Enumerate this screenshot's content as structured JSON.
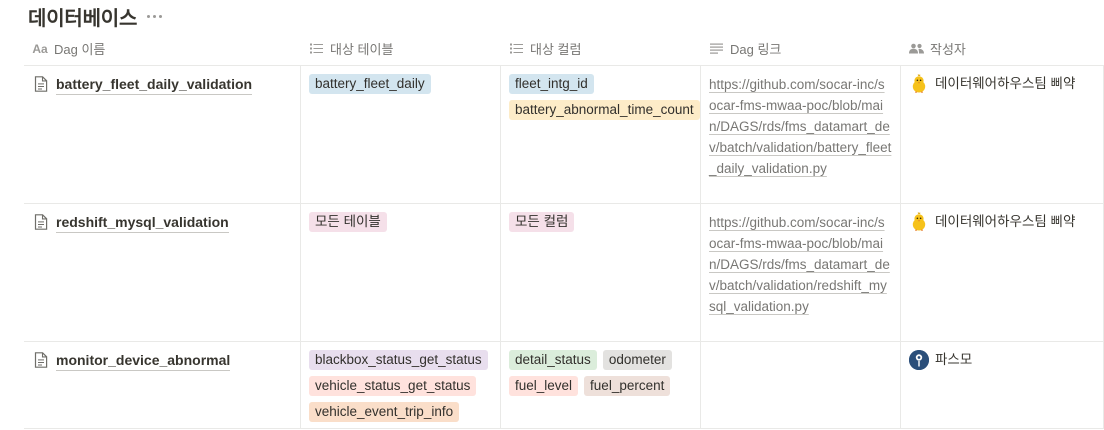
{
  "database": {
    "title": "데이터베이스"
  },
  "columns": {
    "name": {
      "label": "Dag 이름",
      "icon": "Aa"
    },
    "target_table": {
      "label": "대상 테이블",
      "icon": "list-icon"
    },
    "target_column": {
      "label": "대상 컬럼",
      "icon": "list-icon"
    },
    "link": {
      "label": "Dag 링크",
      "icon": "text-icon"
    },
    "author": {
      "label": "작성자",
      "icon": "people-icon"
    }
  },
  "rows": [
    {
      "name": "battery_fleet_daily_validation",
      "tables": [
        {
          "text": "battery_fleet_daily",
          "color": "#d3e5ef"
        }
      ],
      "columns": [
        {
          "text": "fleet_intg_id",
          "color": "#d3e5ef"
        },
        {
          "text": "battery_abnormal_time_count",
          "color": "#fdecc8"
        }
      ],
      "link": "https://github.com/socar-inc/socar-fms-mwaa-poc/blob/main/DAGS/rds/fms_datamart_dev/batch/validation/battery_fleet_daily_validation.py",
      "author": "데이터웨어하우스팀 삐약",
      "author_avatar": "chick-icon"
    },
    {
      "name": "redshift_mysql_validation",
      "tables": [
        {
          "text": "모든 테이블",
          "color": "#f5e0e9"
        }
      ],
      "columns": [
        {
          "text": "모든 컬럼",
          "color": "#f5e0e9"
        }
      ],
      "link": "https://github.com/socar-inc/socar-fms-mwaa-poc/blob/main/DAGS/rds/fms_datamart_dev/batch/validation/redshift_mysql_validation.py",
      "author": "데이터웨어하우스팀 삐약",
      "author_avatar": "chick-icon"
    },
    {
      "name": "monitor_device_abnormal",
      "tables": [
        {
          "text": "blackbox_status_get_status",
          "color": "#e8deee"
        },
        {
          "text": "vehicle_status_get_status",
          "color": "#ffe2dd"
        },
        {
          "text": "vehicle_event_trip_info",
          "color": "#fadec9"
        }
      ],
      "columns": [
        {
          "text": "detail_status",
          "color": "#dbeddb"
        },
        {
          "text": "odometer",
          "color": "#e3e2e0"
        },
        {
          "text": "fuel_level",
          "color": "#ffe2dd"
        },
        {
          "text": "fuel_percent",
          "color": "#eee0da"
        }
      ],
      "link": "",
      "author": "파스모",
      "author_avatar": "pin-icon"
    }
  ]
}
